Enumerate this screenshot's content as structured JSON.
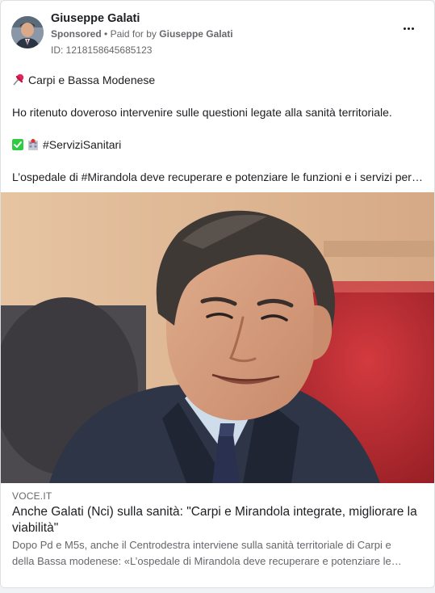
{
  "post": {
    "page_name": "Giuseppe Galati",
    "sponsored_label": "Sponsored",
    "meta_separator": "•",
    "paid_for_prefix": "Paid for by",
    "paid_for_name": "Giuseppe Galati",
    "ad_id": "ID: 1218158645685123",
    "more_icon": "more-horizontal-icon"
  },
  "body": {
    "location_icon": "pushpin-icon",
    "location": "Carpi e Bassa Modenese",
    "paragraph": "Ho ritenuto doveroso intervenire sulle questioni legate alla sanità territoriale.",
    "hashtag_icons": [
      "check-mark-icon",
      "hospital-icon"
    ],
    "hashtag": "#ServiziSanitari",
    "preview": "L’ospedale di #Mirandola deve recuperare e potenziare le funzioni e i servizi persi…"
  },
  "link": {
    "domain": "VOCE.IT",
    "title": "Anche Galati (Nci) sulla sanità: \"Carpi e Mirandola integrate, migliorare la viabilità\"",
    "description_line1": "Dopo Pd e M5s, anche il Centrodestra interviene sulla sanità territoriale di Carpi e",
    "description_line2": "della Bassa modenese: «L’ospedale di Mirandola deve recuperare e potenziare le…"
  },
  "colors": {
    "secondary_text": "#65676b",
    "primary_text": "#1c1e21",
    "check_green": "#2ecc40"
  }
}
